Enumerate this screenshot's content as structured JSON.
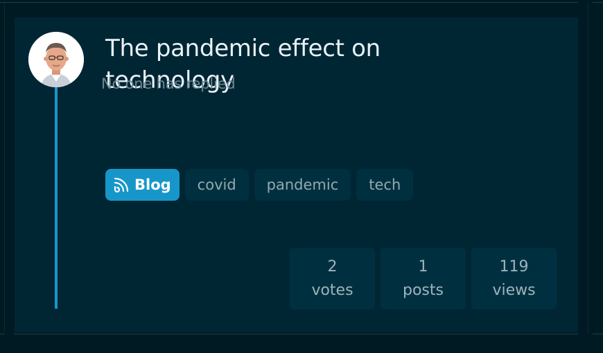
{
  "topic": {
    "title": "The pandemic effect on technology",
    "reply_status": "No one has replied"
  },
  "category": {
    "label": "Blog",
    "icon": "rss-icon",
    "color": "#1797c9"
  },
  "tags": [
    {
      "label": "covid"
    },
    {
      "label": "pandemic"
    },
    {
      "label": "tech"
    }
  ],
  "stats": [
    {
      "value": "2",
      "label": "votes"
    },
    {
      "value": "1",
      "label": "posts"
    },
    {
      "value": "119",
      "label": "views"
    }
  ],
  "colors": {
    "background": "#001a24",
    "card": "#002634",
    "accent": "#1797c9"
  }
}
